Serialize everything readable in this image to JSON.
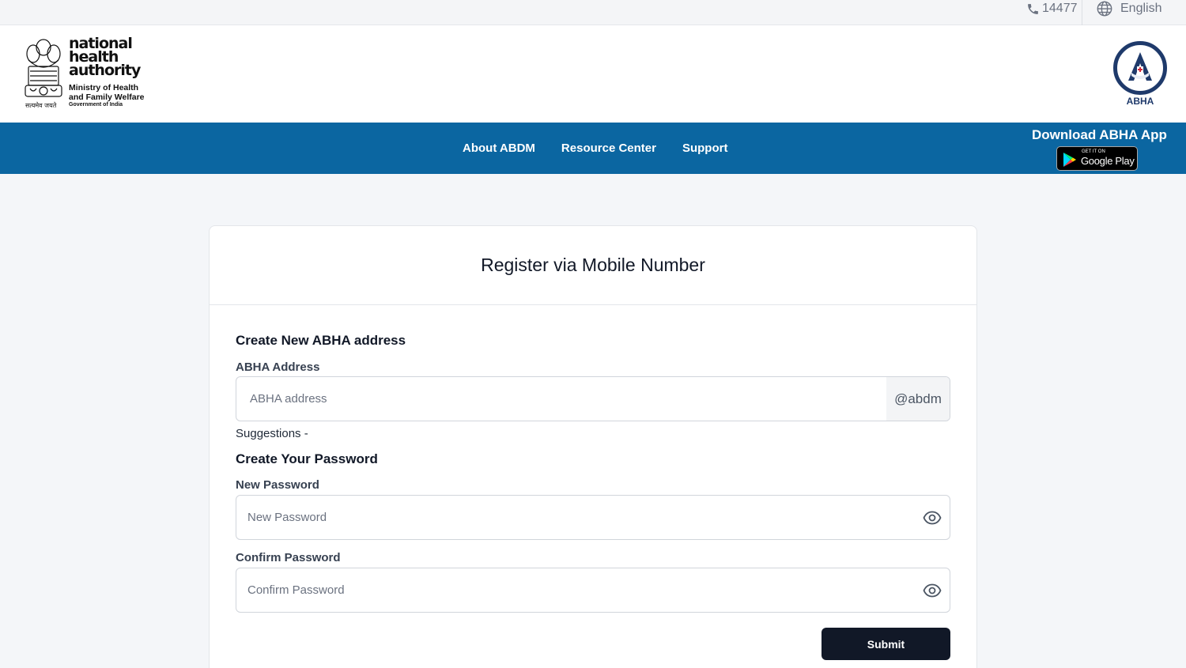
{
  "topbar": {
    "phone_icon": "phone-icon",
    "phone_number": "14477",
    "language_icon": "globe-icon",
    "language": "English"
  },
  "header": {
    "org_name_lines": [
      "national",
      "health",
      "authority"
    ],
    "ministry_lines": [
      "Ministry of Health",
      "and Family Welfare"
    ],
    "government": "Government of India",
    "emblem_motto": "सत्यमेव जयते",
    "abha_logo_text": "ABHA"
  },
  "nav": {
    "items": [
      "About ABDM",
      "Resource Center",
      "Support"
    ],
    "download_label": "Download ABHA App",
    "google_play_small": "GET IT ON",
    "google_play_big": "Google Play"
  },
  "form": {
    "title": "Register via Mobile Number",
    "section_address": "Create New ABHA address",
    "address_label": "ABHA Address",
    "address_placeholder": "ABHA address",
    "address_suffix": "@abdm",
    "suggestions": "Suggestions -",
    "section_password": "Create Your Password",
    "new_password_label": "New Password",
    "new_password_placeholder": "New Password",
    "confirm_password_label": "Confirm Password",
    "confirm_password_placeholder": "Confirm Password",
    "submit_label": "Submit"
  },
  "colors": {
    "nav_bg": "#0b66a1",
    "submit_bg": "#111827",
    "abha_blue": "#1f3a6b",
    "abha_red": "#d62839"
  }
}
